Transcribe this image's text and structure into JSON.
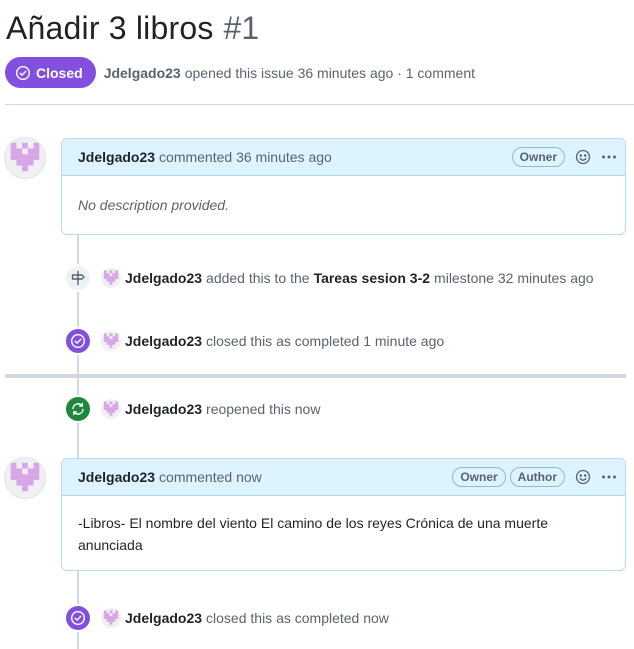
{
  "issue": {
    "title": "Añadir 3 libros",
    "number": "#1",
    "state": "Closed",
    "author": "Jdelgado23",
    "opened_text": "opened this issue 36 minutes ago · 1 comment"
  },
  "comments": [
    {
      "author": "Jdelgado23",
      "time_text": "commented 36 minutes ago",
      "badges": [
        "Owner"
      ],
      "body": "No description provided."
    },
    {
      "author": "Jdelgado23",
      "time_text": "commented now",
      "badges": [
        "Owner",
        "Author"
      ],
      "body": "-Libros- El nombre del viento El camino de los reyes Crónica de una muerte anunciada"
    }
  ],
  "events": {
    "milestone": {
      "author": "Jdelgado23",
      "text_before": "added this to the",
      "milestone": "Tareas sesion 3-2",
      "text_after": "milestone 32 minutes ago",
      "icon": "milestone-icon"
    },
    "closed_1": {
      "author": "Jdelgado23",
      "text": "closed this as completed 1 minute ago",
      "icon": "check-circle-icon"
    },
    "reopened": {
      "author": "Jdelgado23",
      "text": "reopened this now",
      "icon": "sync-icon"
    },
    "closed_2": {
      "author": "Jdelgado23",
      "text": "closed this as completed now",
      "icon": "check-circle-icon"
    }
  },
  "colors": {
    "closed_purple": "#8250df",
    "reopened_green": "#1f883d",
    "comment_header_bg": "#ddf4ff",
    "comment_border": "#b6dcf5",
    "avatar_pink": "#d8a6e6"
  }
}
